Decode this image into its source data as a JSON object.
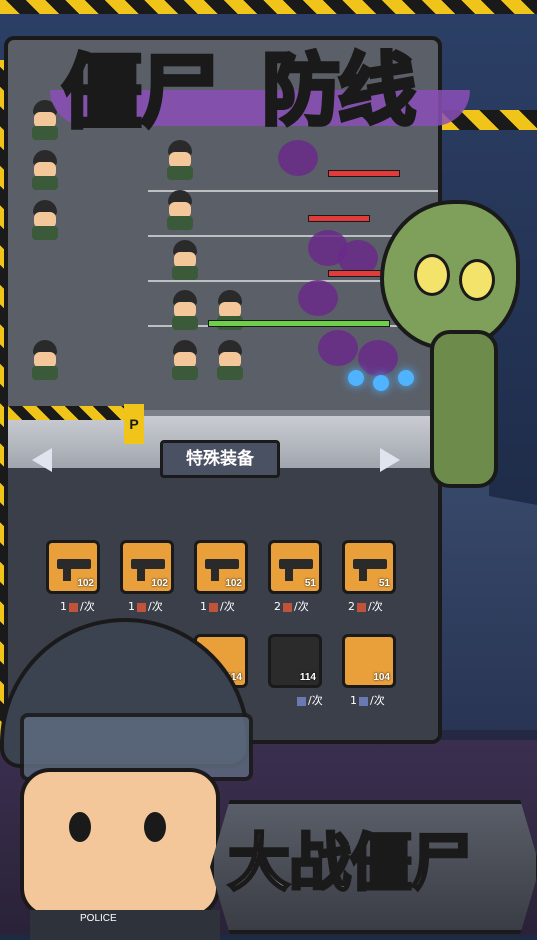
{
  "title_main_left": "僵尸",
  "title_main_right": "防线",
  "panel_title": "特殊装备",
  "equipment_row1": [
    {
      "name": "pistol",
      "count": "102",
      "cost": "1",
      "unit": "/次"
    },
    {
      "name": "smg",
      "count": "102",
      "cost": "1",
      "unit": "/次"
    },
    {
      "name": "shotgun",
      "count": "102",
      "cost": "1",
      "unit": "/次"
    },
    {
      "name": "assault-rifle",
      "count": "51",
      "cost": "2",
      "unit": "/次"
    },
    {
      "name": "rifle",
      "count": "51",
      "cost": "2",
      "unit": "/次"
    }
  ],
  "equipment_row2": [
    {
      "name": "turret",
      "count": "114",
      "cost": "",
      "unit": ""
    },
    {
      "name": "shield",
      "count": "114",
      "cost": "",
      "unit": "/次"
    },
    {
      "name": "helmet",
      "count": "104",
      "cost": "1",
      "unit": "/次"
    }
  ],
  "parking_sign": "P",
  "police_label": "POLICE",
  "banner_text": "大战僵尸",
  "colors": {
    "accent_green": "#7ee04b",
    "hazard_yellow": "#f0c419",
    "item_orange": "#e9a03b"
  }
}
